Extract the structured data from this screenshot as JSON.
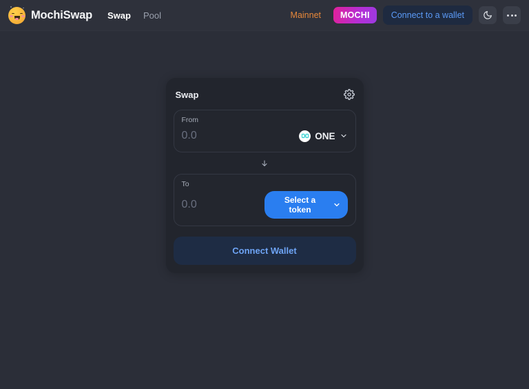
{
  "header": {
    "logo_icon": "mochi-face-icon",
    "brand": "MochiSwap",
    "nav": [
      {
        "label": "Swap",
        "active": true
      },
      {
        "label": "Pool",
        "active": false
      }
    ],
    "network": "Mainnet",
    "token_badge": "MOCHI",
    "connect_wallet": "Connect to a wallet",
    "theme_icon": "moon-icon",
    "more_icon": "more-horizontal-icon"
  },
  "swap_card": {
    "title": "Swap",
    "settings_icon": "gear-icon",
    "from": {
      "label": "From",
      "amount_value": "",
      "amount_placeholder": "0.0",
      "token_symbol": "ONE",
      "token_icon": "harmony-one-icon",
      "chevron_icon": "chevron-down-icon"
    },
    "switch_icon": "arrow-down-icon",
    "to": {
      "label": "To",
      "amount_value": "",
      "amount_placeholder": "0.0",
      "select_token_label": "Select a token",
      "chevron_icon": "chevron-down-icon"
    },
    "action_button": "Connect Wallet"
  },
  "colors": {
    "page_bg": "#2b2e38",
    "header_bg": "#2e313b",
    "card_bg": "#22252d",
    "accent_blue": "#2a7ef0",
    "network_orange": "#e8883a",
    "badge_gradient_start": "#e0219a",
    "badge_gradient_end": "#9b3ae0",
    "connect_text": "#5b9bf8"
  }
}
